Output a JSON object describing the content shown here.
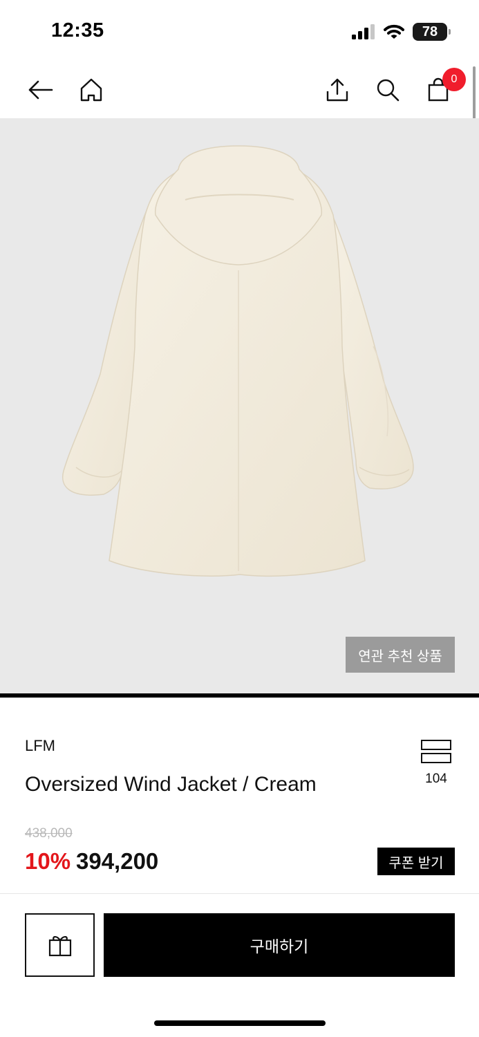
{
  "status_bar": {
    "time": "12:35",
    "battery": "78"
  },
  "nav": {
    "cart_count": "0"
  },
  "image": {
    "background": "#e9e9e9",
    "related_label": "연관 추천 상품"
  },
  "product": {
    "brand": "LFM",
    "name": "Oversized Wind Jacket / Cream",
    "layout_count": "104",
    "original_price": "438,000",
    "discount_rate": "10%",
    "sale_price": "394,200",
    "coupon_label": "쿠폰 받기"
  },
  "bottom_bar": {
    "buy_label": "구매하기"
  },
  "colors": {
    "accent_red": "#e3161b",
    "badge_red": "#f01d2c",
    "black": "#000000"
  },
  "icons": [
    "back-arrow-icon",
    "home-icon",
    "share-icon",
    "search-icon",
    "cart-icon",
    "layout-toggle-icon",
    "gift-icon"
  ]
}
